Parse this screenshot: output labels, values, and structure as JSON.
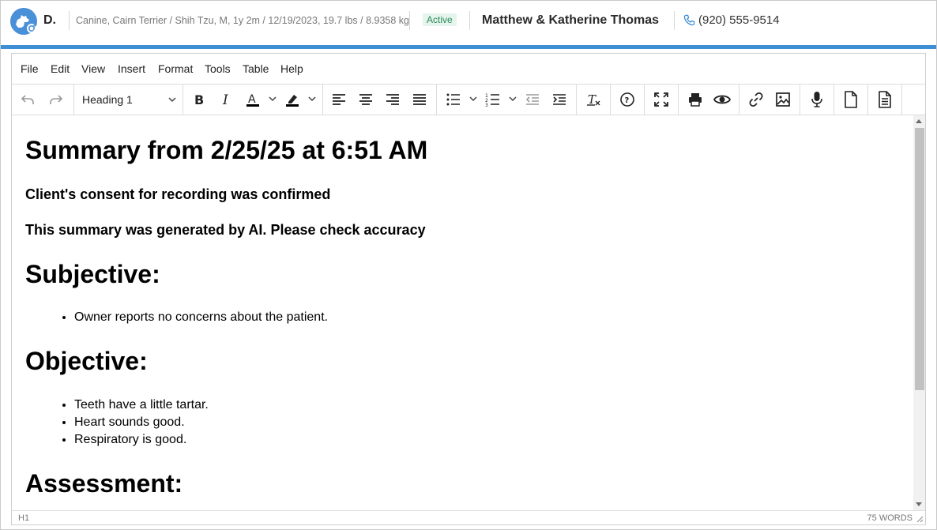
{
  "patient": {
    "name": "D.",
    "info": "Canine, Cairn Terrier / Shih Tzu, M, 1y 2m / 12/19/2023, 19.7 lbs / 8.9358 kg",
    "status": "Active"
  },
  "owner": {
    "name": "Matthew & Katherine Thomas",
    "phone": "(920) 555-9514"
  },
  "menu": [
    "File",
    "Edit",
    "View",
    "Insert",
    "Format",
    "Tools",
    "Table",
    "Help"
  ],
  "toolbar": {
    "block_format": "Heading 1",
    "icons": [
      "undo-icon",
      "redo-icon",
      "bold-icon",
      "italic-icon",
      "text-color-icon",
      "highlight-icon",
      "align-left-icon",
      "align-center-icon",
      "align-right-icon",
      "align-justify-icon",
      "bullet-list-icon",
      "numbered-list-icon",
      "outdent-icon",
      "indent-icon",
      "clear-formatting-icon",
      "help-icon",
      "fullscreen-icon",
      "print-icon",
      "preview-icon",
      "link-icon",
      "image-icon",
      "microphone-icon",
      "document-icon",
      "template-icon"
    ]
  },
  "document": {
    "title": "Summary from 2/25/25 at 6:51 AM",
    "consent_note": "Client's consent for recording was confirmed",
    "ai_note": "This summary was generated by AI. Please check accuracy",
    "subjective_heading": "Subjective:",
    "subjective_items": [
      "Owner reports no concerns about the patient."
    ],
    "objective_heading": "Objective:",
    "objective_items": [
      "Teeth have a little tartar.",
      "Heart sounds good.",
      "Respiratory is good."
    ],
    "assessment_heading": "Assessment:"
  },
  "status_bar": {
    "path": "H1",
    "word_count": "75 WORDS"
  },
  "colors": {
    "accent": "#3f8fd6",
    "status_green": "#2c8a5b"
  }
}
